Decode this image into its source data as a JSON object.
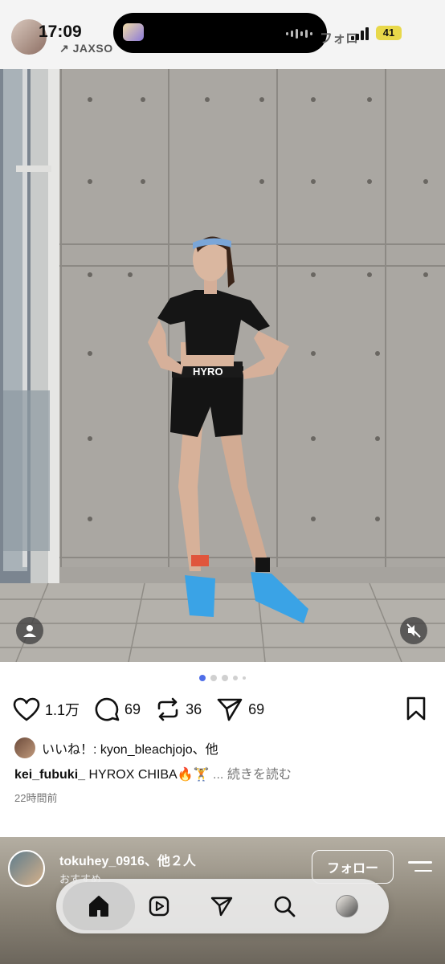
{
  "status_bar": {
    "time": "17:09",
    "battery": "41"
  },
  "header": {
    "author_sub": "↗ JAXSO",
    "follow_label": "フォロ"
  },
  "post": {
    "slide_count": 5,
    "active_slide": 1,
    "actions": {
      "like_count": "1.1万",
      "comment_count": "69",
      "repost_count": "36",
      "share_count": "69"
    },
    "likes_text": "いいね！: kyon_bleachjojo、他",
    "caption_user": "kei_fubuki_",
    "caption_text": "HYROX CHIBA🔥🏋️",
    "more_label": "... 続きを読む",
    "timestamp": "22時間前"
  },
  "next_post": {
    "username": "tokuhey_0916、他２人",
    "subtitle": "おすすめ",
    "follow_label": "フォロー"
  },
  "tabbar": {
    "items": [
      "home-icon",
      "reels-icon",
      "direct-message-icon",
      "search-icon",
      "profile-avatar"
    ]
  },
  "colors": {
    "accent": "#4f6ee8",
    "battery": "#e8d84a"
  }
}
